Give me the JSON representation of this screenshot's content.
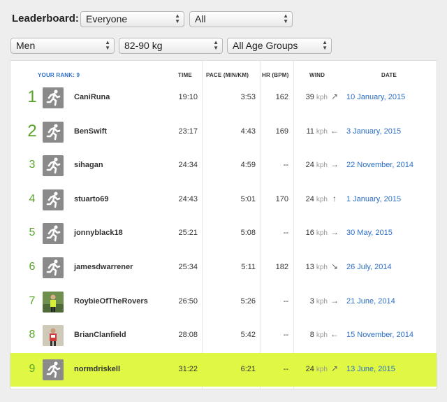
{
  "filters": {
    "label": "Leaderboard:",
    "scope": "Everyone",
    "period": "All",
    "gender": "Men",
    "weight": "82-90 kg",
    "age": "All Age Groups"
  },
  "columns": {
    "rank": "YOUR RANK: 9",
    "time": "TIME",
    "pace": "PACE (MIN/KM)",
    "hr": "HR (BPM)",
    "wind": "WIND",
    "date": "DATE"
  },
  "wind_unit": "kph",
  "rows": [
    {
      "rank": "1",
      "name": "CaniRuna",
      "time": "19:10",
      "pace": "3:53",
      "hr": "162",
      "wind": "39",
      "wind_dir": "north-east-arrow",
      "date": "10 January, 2015",
      "avatar": "runner-icon",
      "highlight": false
    },
    {
      "rank": "2",
      "name": "BenSwift",
      "time": "23:17",
      "pace": "4:43",
      "hr": "169",
      "wind": "11",
      "wind_dir": "west-arrow",
      "date": "3 January, 2015",
      "avatar": "runner-icon",
      "highlight": false
    },
    {
      "rank": "3",
      "name": "sihagan",
      "time": "24:34",
      "pace": "4:59",
      "hr": "--",
      "wind": "24",
      "wind_dir": "east-arrow",
      "date": "22 November, 2014",
      "avatar": "runner-icon",
      "highlight": false
    },
    {
      "rank": "4",
      "name": "stuarto69",
      "time": "24:43",
      "pace": "5:01",
      "hr": "170",
      "wind": "24",
      "wind_dir": "north-arrow",
      "date": "1 January, 2015",
      "avatar": "runner-icon",
      "highlight": false
    },
    {
      "rank": "5",
      "name": "jonnyblack18",
      "time": "25:21",
      "pace": "5:08",
      "hr": "--",
      "wind": "16",
      "wind_dir": "east-arrow",
      "date": "30 May, 2015",
      "avatar": "runner-icon",
      "highlight": false
    },
    {
      "rank": "6",
      "name": "jamesdwarrener",
      "time": "25:34",
      "pace": "5:11",
      "hr": "182",
      "wind": "13",
      "wind_dir": "south-east-arrow",
      "date": "26 July, 2014",
      "avatar": "runner-icon",
      "highlight": false
    },
    {
      "rank": "7",
      "name": "RoybieOfTheRovers",
      "time": "26:50",
      "pace": "5:26",
      "hr": "--",
      "wind": "3",
      "wind_dir": "east-arrow",
      "date": "21 June, 2014",
      "avatar": "profile-photo",
      "highlight": false
    },
    {
      "rank": "8",
      "name": "BrianClanfield",
      "time": "28:08",
      "pace": "5:42",
      "hr": "--",
      "wind": "8",
      "wind_dir": "west-arrow",
      "date": "15 November, 2014",
      "avatar": "profile-photo",
      "highlight": false
    },
    {
      "rank": "9",
      "name": "normdriskell",
      "time": "31:22",
      "pace": "6:21",
      "hr": "--",
      "wind": "24",
      "wind_dir": "north-east-arrow",
      "date": "13 June, 2015",
      "avatar": "runner-icon",
      "highlight": true
    }
  ],
  "colors": {
    "rank_green": "#5aa42a",
    "link_blue": "#2b6ec8",
    "highlight": "#e0f744"
  }
}
